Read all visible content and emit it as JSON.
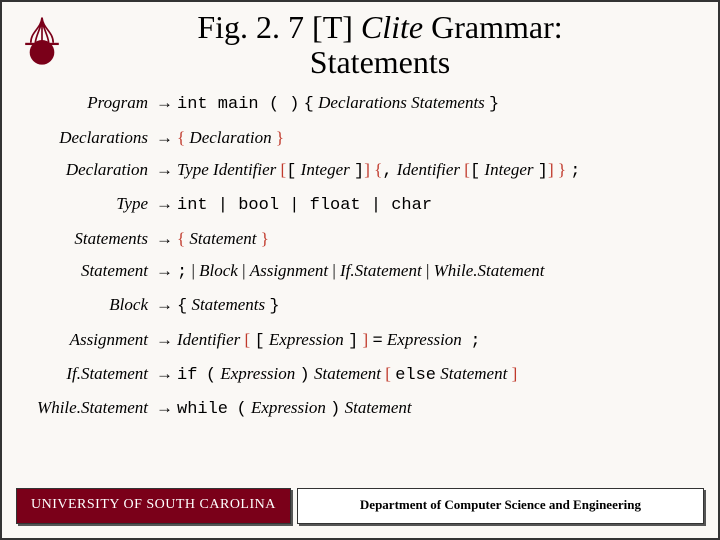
{
  "title_prefix": "Fig. 2. 7 [T] ",
  "title_italic": "Clite",
  "title_suffix": " Grammar:",
  "title_line2": "Statements",
  "rules": {
    "program_lhs": "Program",
    "program_rhs_tt1": "int main ( )",
    "program_rhs_tt2": "{",
    "program_rhs_nt1": "Declarations Statements",
    "program_rhs_tt3": "}",
    "declarations_lhs": "Declarations",
    "declarations_m1": "{",
    "declarations_nt": "Declaration",
    "declarations_m2": "}",
    "declaration_lhs": "Declaration",
    "declaration_nt1": "Type Identifier",
    "declaration_m1": "[",
    "declaration_tt1": "[",
    "declaration_nt2": "Integer",
    "declaration_tt2": "]",
    "declaration_m2": "]",
    "declaration_m3": "{",
    "declaration_tt3": ",",
    "declaration_nt3": "Identifier",
    "declaration_m4": "[",
    "declaration_tt4": "[",
    "declaration_nt4": "Integer",
    "declaration_tt5": "]",
    "declaration_m5": "]",
    "declaration_m6": "}",
    "declaration_tt6": ";",
    "type_lhs": "Type",
    "type_rhs": "int | bool | float | char",
    "statements_lhs": "Statements",
    "statements_m1": "{",
    "statements_nt": "Statement",
    "statements_m2": "}",
    "statement_lhs": "Statement",
    "statement_tt1": ";",
    "statement_sep": " | ",
    "statement_nt1": "Block",
    "statement_nt2": "Assignment",
    "statement_nt3": "If.Statement",
    "statement_nt4": "While.Statement",
    "block_lhs": "Block",
    "block_tt1": "{",
    "block_nt": "Statements",
    "block_tt2": "}",
    "assignment_lhs": "Assignment",
    "assignment_nt1": "Identifier",
    "assignment_m1": "[",
    "assignment_tt1": "[",
    "assignment_nt2": "Expression",
    "assignment_tt2": "]",
    "assignment_m2": "]",
    "assignment_tt3": "=",
    "assignment_nt3": "Expression",
    "assignment_tt4": ";",
    "if_lhs": "If.Statement",
    "if_tt1": "if",
    "if_tt2": "(",
    "if_nt1": "Expression",
    "if_tt3": ")",
    "if_nt2": "Statement",
    "if_m1": "[",
    "if_tt4": "else",
    "if_nt3": "Statement",
    "if_m2": "]",
    "while_lhs": "While.Statement",
    "while_tt1": "while",
    "while_tt2": "(",
    "while_nt1": "Expression",
    "while_tt3": ")",
    "while_nt2": "Statement"
  },
  "arrow": "→",
  "footer_left": "UNIVERSITY OF SOUTH CAROLINA",
  "footer_right": "Department of Computer Science and Engineering"
}
